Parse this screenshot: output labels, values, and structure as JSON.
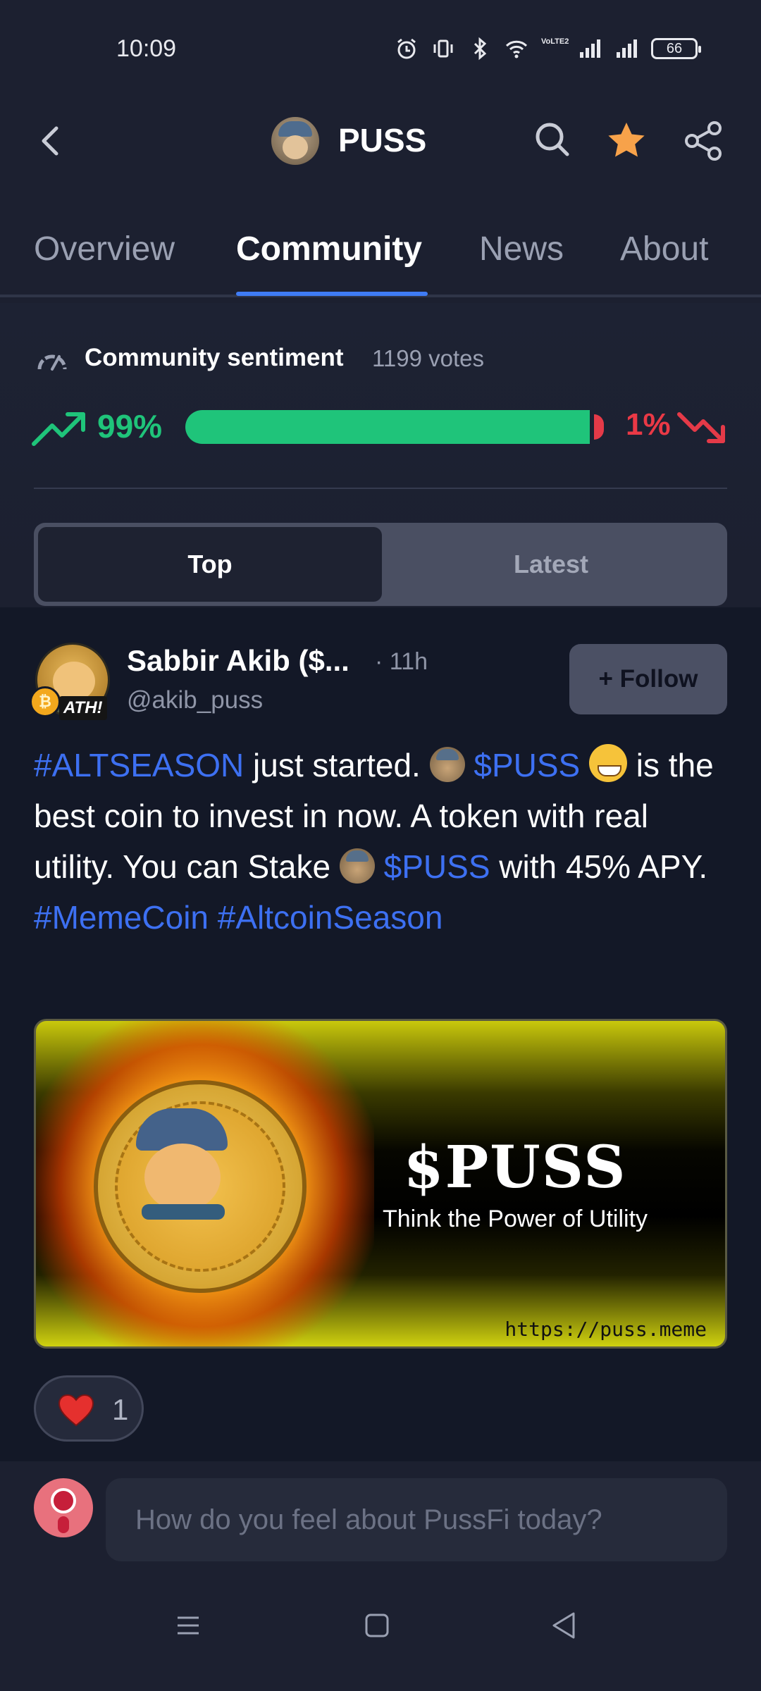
{
  "status_bar": {
    "time": "10:09",
    "battery": "66",
    "network": "VoLTE2"
  },
  "header": {
    "title": "PUSS",
    "star_color": "#f7a24a"
  },
  "tabs": [
    {
      "label": "Overview",
      "active": false
    },
    {
      "label": "Community",
      "active": true
    },
    {
      "label": "News",
      "active": false
    },
    {
      "label": "About",
      "active": false
    }
  ],
  "sentiment": {
    "label": "Community sentiment",
    "votes": "1199 votes",
    "bullish_pct": "99%",
    "bearish_pct": "1%",
    "bullish_fraction": 0.99,
    "bullish_color": "#1fc47a",
    "bearish_color": "#e53a48"
  },
  "feed_toggle": {
    "top_label": "Top",
    "latest_label": "Latest",
    "selected": "Top"
  },
  "post": {
    "author": "Sabbir Akib ($...",
    "time": "· 11h",
    "handle": "@akib_puss",
    "follow_label": "+ Follow",
    "badge": "ATH!",
    "text": {
      "tag_altseason": "#ALTSEASON",
      "t1": " just started. ",
      "ticker1": "$PUSS",
      "t2": " is the best coin to invest in now. A token with real utility. You can Stake ",
      "ticker2": "$PUSS",
      "t3": " with 45% APY.",
      "tag_memecoin": "#MemeCoin",
      "tag_altcoinseason": "#AltcoinSeason"
    },
    "image": {
      "title": "$PUSS",
      "subtitle": "Think the Power of Utility",
      "url": "https://puss.meme"
    },
    "likes": "1"
  },
  "composer": {
    "placeholder": "How do you feel about PussFi today?"
  }
}
